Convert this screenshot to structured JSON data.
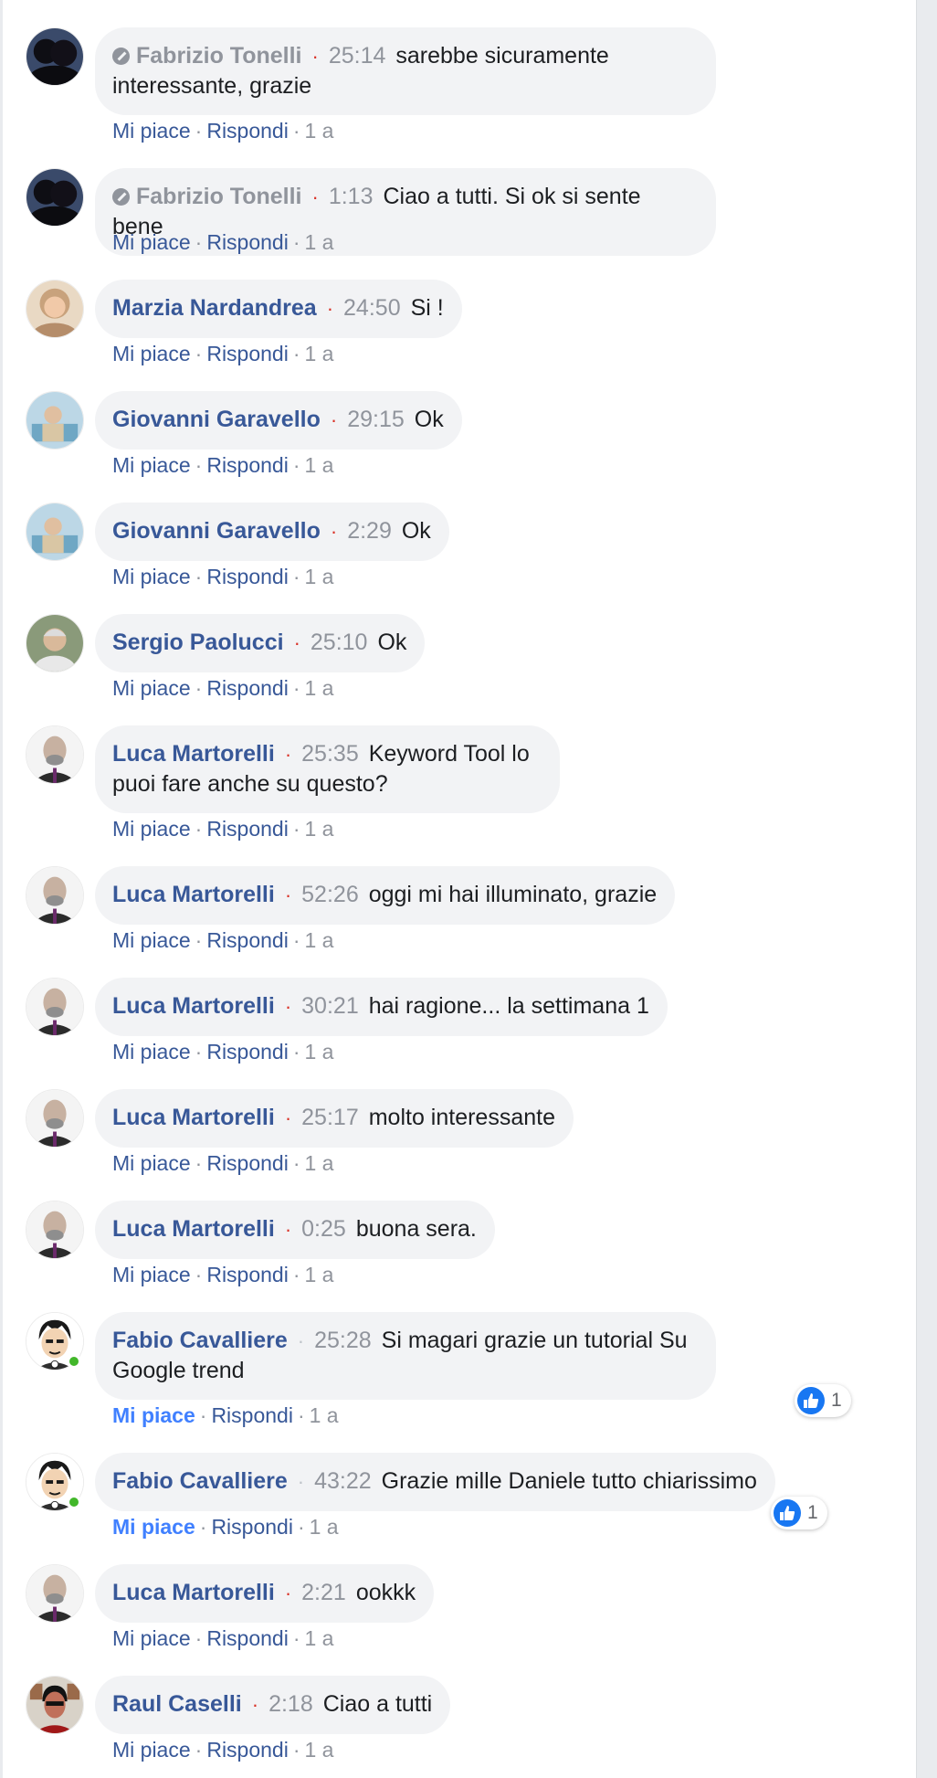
{
  "comments": [
    {
      "author": "Fabrizio Tonelli",
      "verified": true,
      "time": "25:14",
      "text": "sarebbe sicuramente interessante, grazie",
      "like": "Mi piace",
      "reply": "Rispondi",
      "age": "1 a"
    },
    {
      "author": "Fabrizio Tonelli",
      "verified": true,
      "time": "1:13",
      "text": "Ciao a tutti. Si ok si sente bene",
      "like": "Mi piace",
      "reply": "Rispondi",
      "age": "1 a"
    },
    {
      "author": "Marzia Nardandrea",
      "time": "24:50",
      "text": "Si !",
      "like": "Mi piace",
      "reply": "Rispondi",
      "age": "1 a"
    },
    {
      "author": "Giovanni Garavello",
      "time": "29:15",
      "text": "Ok",
      "like": "Mi piace",
      "reply": "Rispondi",
      "age": "1 a"
    },
    {
      "author": "Giovanni Garavello",
      "time": "2:29",
      "text": "Ok",
      "like": "Mi piace",
      "reply": "Rispondi",
      "age": "1 a"
    },
    {
      "author": "Sergio Paolucci",
      "time": "25:10",
      "text": "Ok",
      "like": "Mi piace",
      "reply": "Rispondi",
      "age": "1 a"
    },
    {
      "author": "Luca Martorelli",
      "time": "25:35",
      "text": "Keyword Tool lo puoi fare anche su questo?",
      "like": "Mi piace",
      "reply": "Rispondi",
      "age": "1 a"
    },
    {
      "author": "Luca Martorelli",
      "time": "52:26",
      "text": "oggi mi hai illuminato, grazie",
      "like": "Mi piace",
      "reply": "Rispondi",
      "age": "1 a"
    },
    {
      "author": "Luca Martorelli",
      "time": "30:21",
      "text": "hai ragione... la settimana 1",
      "like": "Mi piace",
      "reply": "Rispondi",
      "age": "1 a"
    },
    {
      "author": "Luca Martorelli",
      "time": "25:17",
      "text": "molto interessante",
      "like": "Mi piace",
      "reply": "Rispondi",
      "age": "1 a"
    },
    {
      "author": "Luca Martorelli",
      "time": "0:25",
      "text": "buona sera.",
      "like": "Mi piace",
      "reply": "Rispondi",
      "age": "1 a"
    },
    {
      "author": "Fabio Cavalliere",
      "time": "25:28",
      "text": "Si magari grazie un tutorial Su Google trend",
      "like": "Mi piace",
      "reply": "Rispondi",
      "age": "1 a",
      "reactions": "1",
      "online": true,
      "liked": true
    },
    {
      "author": "Fabio Cavalliere",
      "time": "43:22",
      "text": "Grazie mille Daniele tutto chiarissimo",
      "like": "Mi piace",
      "reply": "Rispondi",
      "age": "1 a",
      "reactions": "1",
      "online": true,
      "liked": true
    },
    {
      "author": "Luca Martorelli",
      "time": "2:21",
      "text": "ookkk",
      "like": "Mi piace",
      "reply": "Rispondi",
      "age": "1 a"
    },
    {
      "author": "Raul Caselli",
      "time": "2:18",
      "text": "Ciao a tutti",
      "like": "Mi piace",
      "reply": "Rispondi",
      "age": "1 a"
    }
  ],
  "icons": {
    "verified": "checkmark-circle-icon",
    "like_reaction": "thumbs-up-icon"
  },
  "colors": {
    "link": "#385898",
    "liked": "#4080ff",
    "bubble": "#f2f3f5",
    "meta": "#90949c",
    "online": "#42b72a",
    "reaction": "#1877f2"
  }
}
